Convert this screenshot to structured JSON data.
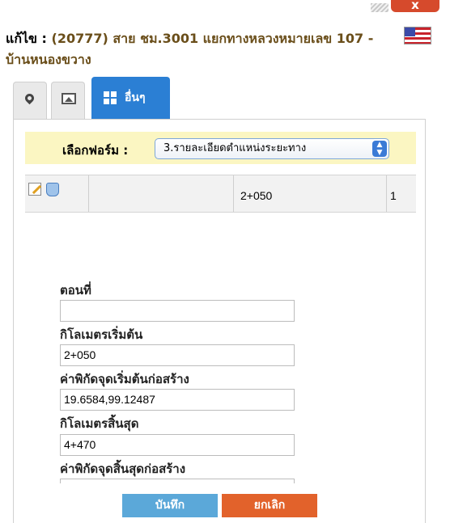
{
  "header": {
    "title_label": "แก้ไข :",
    "title_text": "(20777) สาย ชม.3001 แยกทางหลวงหมายเลข 107 - บ้านหนองขวาง",
    "close_label": "x"
  },
  "tabs": [
    {
      "icon": "map-pin-icon",
      "label": ""
    },
    {
      "icon": "image-icon",
      "label": ""
    },
    {
      "icon": "grid-icon",
      "label": "อื่นๆ"
    }
  ],
  "form_select": {
    "label": "เลือกฟอร์ม :",
    "selected": "3.รายละเอียดตำแหน่งระยะทาง"
  },
  "table": {
    "rows": [
      {
        "col_blank": "",
        "km": "2+050",
        "cut": "1"
      }
    ]
  },
  "fields": [
    {
      "label": "ตอนที่",
      "value": ""
    },
    {
      "label": "กิโลเมตรเริ่มต้น",
      "value": "2+050"
    },
    {
      "label": "ค่าพิกัดจุดเริ่มต้นก่อสร้าง",
      "value": "19.6584,99.12487"
    },
    {
      "label": "กิโลเมตรสิ้นสุด",
      "value": "4+470"
    },
    {
      "label": "ค่าพิกัดจุดสิ้นสุดก่อสร้าง",
      "value": ""
    }
  ],
  "buttons": {
    "save": "บันทึก",
    "cancel": "ยกเลิก"
  },
  "colors": {
    "active_tab": "#2b7fd4",
    "save_button": "#5ba8d9",
    "cancel_button": "#e2622b",
    "close_button": "#d64a2c",
    "select_bar": "#fbf6c2"
  }
}
